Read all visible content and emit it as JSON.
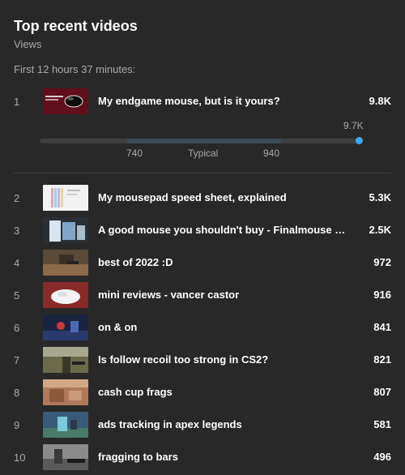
{
  "header": {
    "title": "Top recent videos",
    "subtitle": "Views",
    "period": "First 12 hours 37 minutes:"
  },
  "top_video": {
    "rank": "1",
    "title": "My endgame mouse, but is it yours?",
    "views": "9.8K",
    "range": {
      "current_label": "9.7K",
      "low_label": "740",
      "typical_label": "Typical",
      "high_label": "940",
      "accent_color": "#3ea6ff"
    }
  },
  "videos": [
    {
      "rank": "2",
      "title": "My mousepad speed sheet, explained",
      "views": "5.3K"
    },
    {
      "rank": "3",
      "title": "A good mouse you shouldn't buy - Finalmouse Starlight",
      "views": "2.5K"
    },
    {
      "rank": "4",
      "title": "best of 2022 :D",
      "views": "972"
    },
    {
      "rank": "5",
      "title": "mini reviews - vancer castor",
      "views": "916"
    },
    {
      "rank": "6",
      "title": "on & on",
      "views": "841"
    },
    {
      "rank": "7",
      "title": "Is follow recoil too strong in CS2?",
      "views": "821"
    },
    {
      "rank": "8",
      "title": "cash cup frags",
      "views": "807"
    },
    {
      "rank": "9",
      "title": "ads tracking in apex legends",
      "views": "581"
    },
    {
      "rank": "10",
      "title": "fragging to bars",
      "views": "496"
    }
  ]
}
